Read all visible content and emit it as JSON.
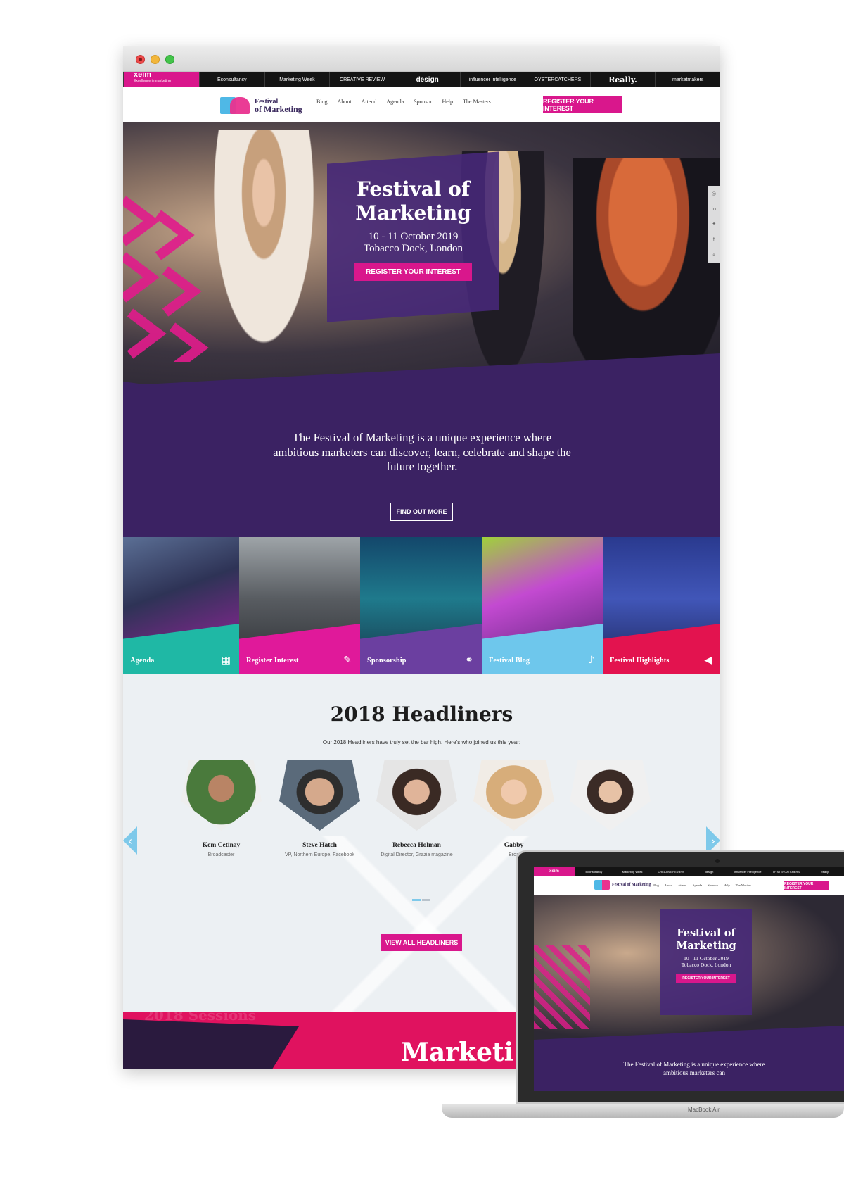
{
  "browser": {
    "brands": [
      "xeim",
      "Econsultancy",
      "Marketing Week",
      "CREATIVE REVIEW",
      "design",
      "influencer intelligence",
      "OYSTERCATCHERS",
      "Really.",
      "marketmakers"
    ],
    "xeim_tagline": "Excellence in marketing"
  },
  "nav": {
    "logo_line1": "Festival",
    "logo_line2": "of Marketing",
    "items": [
      "Blog",
      "About",
      "Attend",
      "Agenda",
      "Sponsor",
      "Help",
      "The Masters"
    ],
    "cta": "REGISTER YOUR INTEREST"
  },
  "hero": {
    "title": "Festival of Marketing",
    "date": "10 - 11 October 2019",
    "venue": "Tobacco Dock, London",
    "cta": "REGISTER YOUR INTEREST",
    "social_icons": [
      "instagram-icon",
      "linkedin-icon",
      "twitter-icon",
      "facebook-icon",
      "search-icon"
    ]
  },
  "intro": {
    "text": "The Festival of Marketing is a unique experience where ambitious marketers can discover, learn, celebrate and shape the future together.",
    "button": "FIND OUT MORE"
  },
  "tiles": [
    {
      "label": "Agenda",
      "icon": "calendar-icon",
      "color": "#1fb8a5"
    },
    {
      "label": "Register Interest",
      "icon": "ticket-icon",
      "color": "#e0199a"
    },
    {
      "label": "Sponsorship",
      "icon": "handshake-icon",
      "color": "#6b3fa0"
    },
    {
      "label": "Festival Blog",
      "icon": "microphone-icon",
      "color": "#6ec7ec"
    },
    {
      "label": "Festival Highlights",
      "icon": "megaphone-icon",
      "color": "#e3134f"
    }
  ],
  "headliners": {
    "title": "2018 Headliners",
    "subtitle": "Our 2018 Headliners have truly set the bar high. Here's who joined us this year:",
    "speakers": [
      {
        "name": "Kem Cetinay",
        "role": "Broadcaster"
      },
      {
        "name": "Steve Hatch",
        "role": "VP, Northern Europe, Facebook"
      },
      {
        "name": "Rebecca Holman",
        "role": "Digital Director, Grazia magazine"
      },
      {
        "name": "Gabby",
        "role": "Broa"
      },
      {
        "name": "",
        "role": ""
      }
    ],
    "view_all": "VIEW ALL HEADLINERS"
  },
  "strip": {
    "ghost_text": "2018 Sessions",
    "big_text": "Marketi"
  },
  "laptop": {
    "model": "MacBook Air",
    "brands": [
      "xeim",
      "Econsultancy",
      "Marketing Week",
      "CREATIVE REVIEW",
      "design",
      "influencer intelligence",
      "OYSTERCATCHERS",
      "Really."
    ],
    "nav_items": [
      "Blog",
      "About",
      "Attend",
      "Agenda",
      "Sponsor",
      "Help",
      "The Masters"
    ],
    "logo": "Festival of Marketing",
    "cta": "REGISTER YOUR INTEREST",
    "hero_title": "Festival of Marketing",
    "hero_date": "10 - 11 October 2019",
    "hero_venue": "Tobacco Dock, London",
    "hero_cta": "REGISTER YOUR INTEREST",
    "intro_text": "The Festival of Marketing is a unique experience where ambitious marketers can"
  }
}
